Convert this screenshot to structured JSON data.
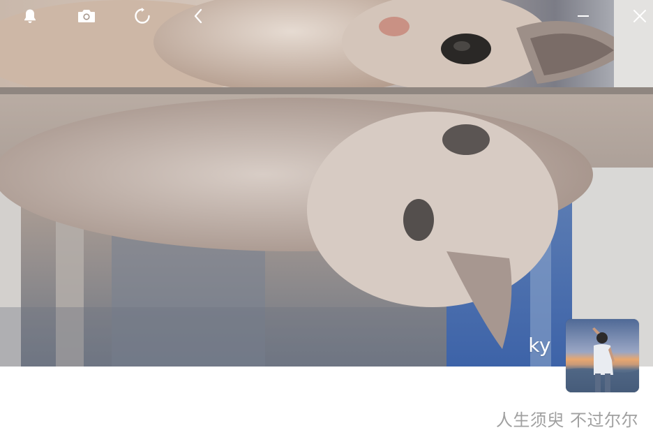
{
  "toolbar": {
    "icons": [
      "bell-icon",
      "camera-icon",
      "refresh-icon",
      "back-chevron-icon",
      "minimize-icon",
      "close-icon"
    ]
  },
  "cover": {
    "description_icon": "cover-photo"
  },
  "profile": {
    "name": "ky",
    "signature": "人生须臾 不过尔尔"
  },
  "colors": {
    "toolbar_icon": "#ffffff",
    "signature_text": "#a0a0a0",
    "name_text": "#ffffff",
    "background": "#ffffff"
  }
}
